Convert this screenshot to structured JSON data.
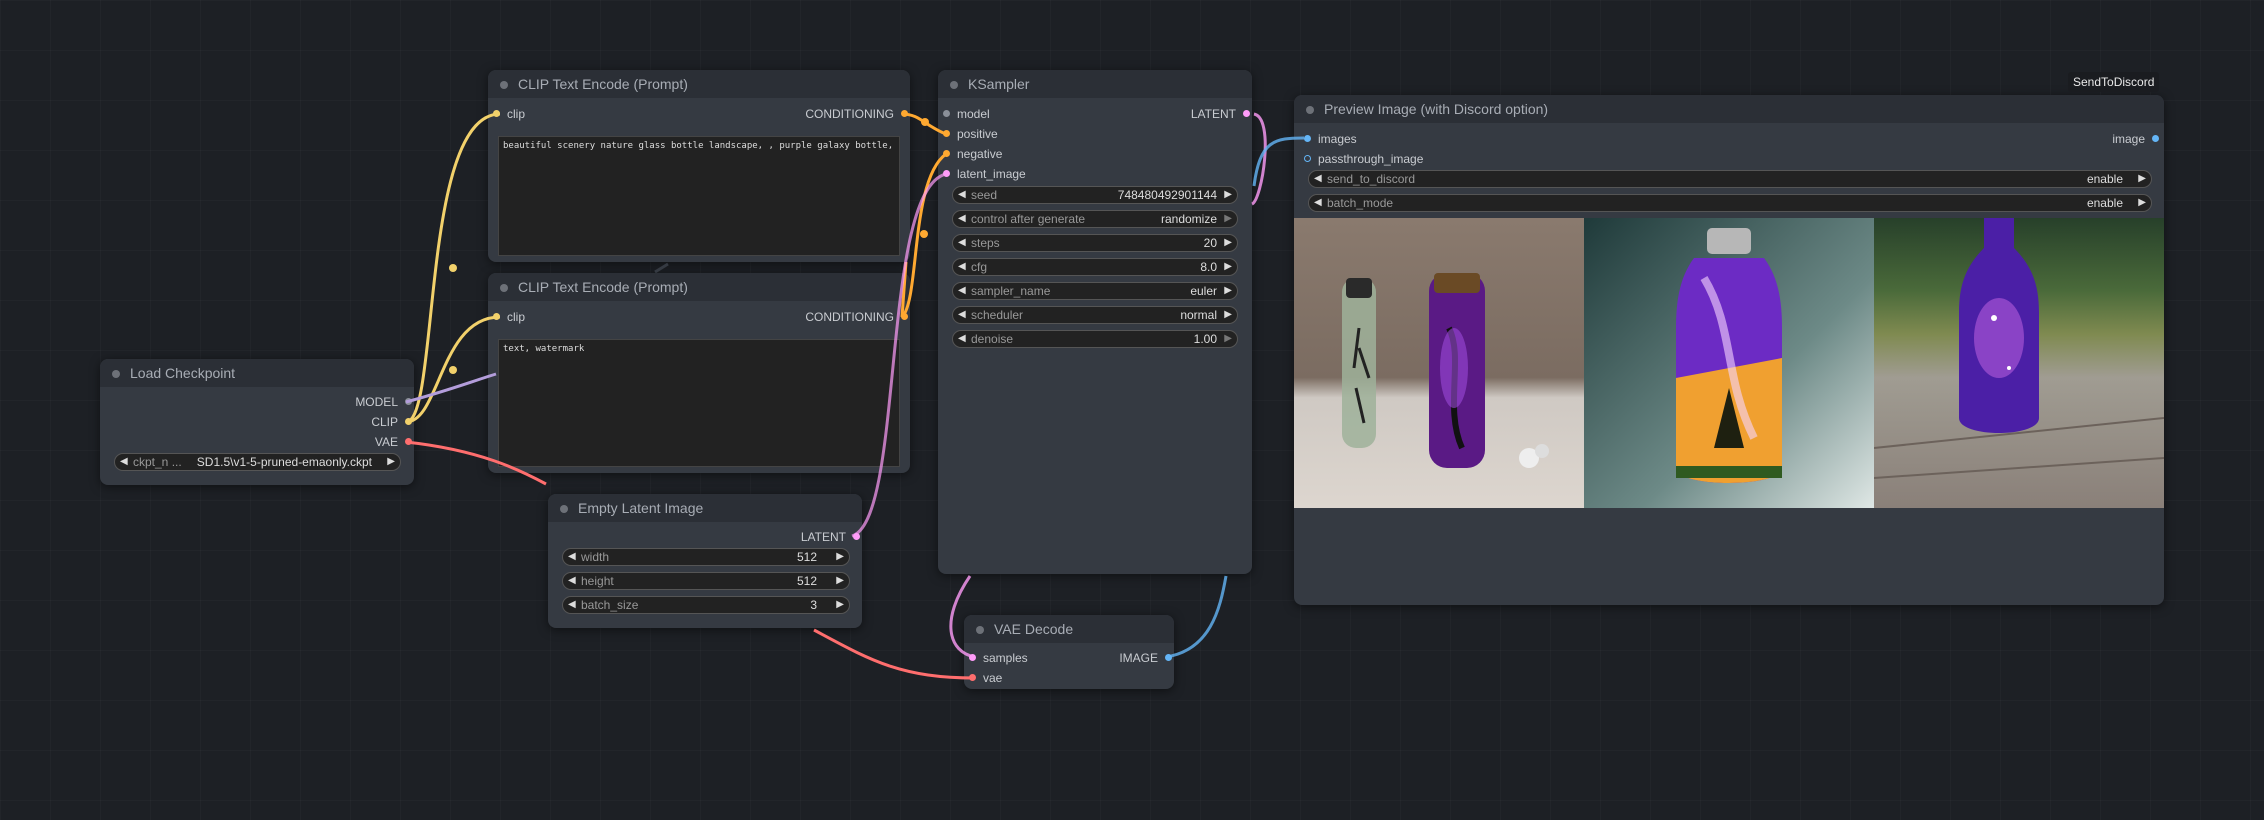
{
  "colors": {
    "clip": "#f2d16b",
    "model": "#b39ddb",
    "vae": "#ff6e6e",
    "conditioning": "#ffa931",
    "latent": "#ff9cf9",
    "image": "#64b5f6",
    "dot_gray": "#8a8f98"
  },
  "load_checkpoint": {
    "title": "Load Checkpoint",
    "outputs": [
      "MODEL",
      "CLIP",
      "VAE"
    ],
    "widget": {
      "label": "ckpt_n ...",
      "value": "SD1.5\\v1-5-pruned-emaonly.ckpt"
    }
  },
  "clip_pos": {
    "title": "CLIP Text Encode (Prompt)",
    "input": "clip",
    "output": "CONDITIONING",
    "text": "beautiful scenery nature glass bottle landscape, , purple galaxy bottle,"
  },
  "clip_neg": {
    "title": "CLIP Text Encode (Prompt)",
    "input": "clip",
    "output": "CONDITIONING",
    "text": "text, watermark"
  },
  "empty_latent": {
    "title": "Empty Latent Image",
    "output": "LATENT",
    "widgets": [
      {
        "label": "width",
        "value": "512"
      },
      {
        "label": "height",
        "value": "512"
      },
      {
        "label": "batch_size",
        "value": "3"
      }
    ]
  },
  "ksampler": {
    "title": "KSampler",
    "inputs": [
      "model",
      "positive",
      "negative",
      "latent_image"
    ],
    "output": "LATENT",
    "widgets": [
      {
        "label": "seed",
        "value": "748480492901144"
      },
      {
        "label": "control after generate",
        "value": "randomize"
      },
      {
        "label": "steps",
        "value": "20"
      },
      {
        "label": "cfg",
        "value": "8.0"
      },
      {
        "label": "sampler_name",
        "value": "euler"
      },
      {
        "label": "scheduler",
        "value": "normal"
      },
      {
        "label": "denoise",
        "value": "1.00"
      }
    ]
  },
  "vae_decode": {
    "title": "VAE Decode",
    "inputs": [
      "samples",
      "vae"
    ],
    "output": "IMAGE"
  },
  "preview": {
    "badge": "SendToDiscord",
    "title": "Preview Image (with Discord option)",
    "inputs": [
      "images",
      "passthrough_image"
    ],
    "output": "image",
    "widgets": [
      {
        "label": "send_to_discord",
        "value": "enable"
      },
      {
        "label": "batch_mode",
        "value": "enable"
      }
    ]
  }
}
